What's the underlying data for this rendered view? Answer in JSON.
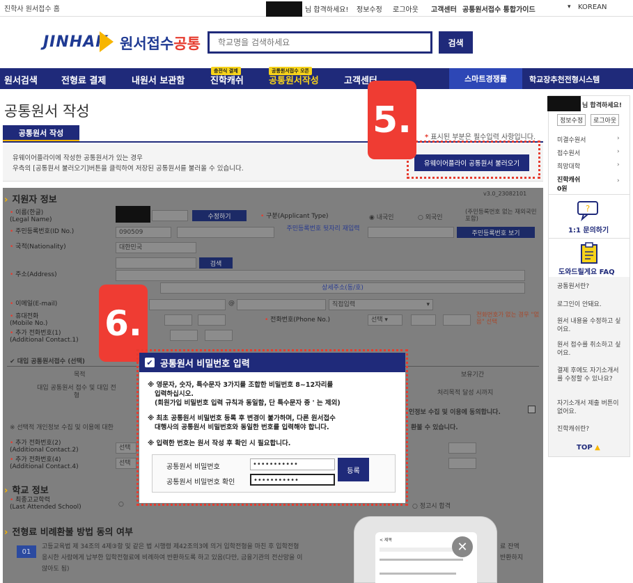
{
  "topbar": {
    "home": "진학사 원서접수 홈",
    "greeting": "님 합격하세요!",
    "links": [
      "정보수정",
      "로그아웃",
      "고객센터"
    ],
    "guide": "공통원서접수 통합가이드",
    "language": "KOREAN"
  },
  "header": {
    "logo_brand": "JINHAK",
    "logo_title_a": "원서접수",
    "logo_title_b": "공통",
    "search_placeholder": "학교명을 검색하세요",
    "search_button": "검색"
  },
  "nav": {
    "items": [
      "원서검색",
      "전형료 결제",
      "내원서 보관함",
      "진학캐쉬",
      "공통원서작성",
      "고객센터"
    ],
    "badges": {
      "cash": "충전식 결제",
      "common": "공통원서접수 오픈"
    },
    "smart": "스마트경쟁률",
    "school": "학교장추천전형시스템"
  },
  "page": {
    "title": "공통원서 작성",
    "tab": "공통원서 작성",
    "required_note_mark": "*",
    "required_note": "표시된 부분은 필수입력 사항입니다.",
    "info_line1": "유웨이어플라이에 작성한 공통원서가 있는 경우",
    "info_line2": "우측의 [공통원서 불러오기]버튼을 클릭하여 저장된 공통원서를 불러올 수 있습니다.",
    "load_button": "유웨이어플라이 공통원서 불러오기",
    "step5": "5.",
    "step6": "6."
  },
  "form": {
    "section1": "지원자 정보",
    "version": "v3.0_23082101",
    "name_label": "이름(한글)",
    "name_sub": "(Legal Name)",
    "edit_button": "수정하기",
    "type_label": "구분(Applicant Type)",
    "type_domestic": "내국인",
    "type_foreign": "외국인",
    "type_note": "(주민등록번호 없는 재외국민 포함)",
    "rrn_label": "주민등록번호(ID No.)",
    "rrn_value": "090509",
    "rrn_note": "주민등록번호 뒷자리 재입력",
    "rrn_show": "주민등록번호 보기",
    "nation_label": "국적(Nationality)",
    "nation_value": "대한민국",
    "addr_label": "주소(Address)",
    "addr_search": "검색",
    "addr_detail": "상세주소(동/호)",
    "email_label": "이메일(E-mail)",
    "email_at": "@",
    "email_direct": "직접입력",
    "mobile_label": "휴대전화",
    "mobile_sub": "(Mobile No.)",
    "phone_label": "전화번호(Phone No.)",
    "phone_select": "선택",
    "phone_note": "전화번호가 없는 경우 \"없음\" 선택",
    "extra1_label": "추가 전화번호(1)",
    "extra1_sub": "(Additional Contact.1)",
    "proxy_title": "대입 공통원서접수 (선택)",
    "th_purpose": "목적",
    "th_period": "보유기간",
    "td_purpose": "대입 공통원서 접수 및 대입 전형",
    "td_period": "처리목적 달성 시까지",
    "agree_text": "인정보 수집 및 이용에 동의합니다.",
    "optional_note": "※ 선택적 개인정보 수집 및 이용에 대한",
    "optional_note2": "환불 수 있습니다.",
    "extra2_label": "추가 전화번호(2)",
    "extra2_sub": "(Additional Contact.2)",
    "extra4_label": "추가 전화번호(4)",
    "extra4_sub": "(Additional Contact.4)",
    "select": "선택",
    "section2": "학교 정보",
    "school_label": "최종고교학력",
    "school_sub": "(Last Attended School)",
    "ged": "정고시 합격",
    "section3": "전형료 비례환불 방법 동의 여부",
    "refund_no": "01",
    "refund_line1": "고등교육법 제 34조의 4제③항 및 같은 법 시행령 제42조의3에 의거 입학전형을 마친 후 입학전형",
    "refund_line2": "응시한 사람에게 납부한 입학전형료에 비례하여 반환하도록 하고 있음(다만, 금융기관의 전산망을 이",
    "refund_line3": "않아도 됨)",
    "refund_tail1": "료 잔액",
    "refund_tail2": "반환하지"
  },
  "modal": {
    "title": "공통원서 비밀번호 입력",
    "note1a": "※ 영문자, 숫자, 특수문자 3가지를 조합한 비밀번호 8~12자리를",
    "note1b": "입력하십시오.",
    "note1c": "(회원가입 비밀번호 입력 규칙과 동일함, 단 특수문자 중 ' 는 제외)",
    "note2a": "※ 최초 공통원서 비밀번호 등록 후 변경이 불가하며, 다른 원서접수",
    "note2b": "대행사의 공통원서 비밀번호와 동일한 번호를 입력해야 합니다.",
    "note3": "※ 입력한 번호는 원서 작성 후 확인 시 필요합니다.",
    "pw_label": "공통원서 비밀번호",
    "pw_value": "•••••••••••",
    "pw_confirm_label": "공통원서 비밀번호 확인",
    "pw_confirm_value": "•••••••••••",
    "register": "등록"
  },
  "sidebar": {
    "greeting": "님 합격하세요!",
    "edit": "정보수정",
    "logout": "로그아웃",
    "menu": [
      "미결수원서",
      "접수원서",
      "희망대학"
    ],
    "cash_label": "진학캐쉬",
    "cash_value": "0원",
    "qa": "1:1 문의하기",
    "faq_title": "도와드릴게요 FAQ",
    "faq": [
      "공통원서란?",
      "로그인이 안돼요.",
      "원서 내용을 수정하고 싶어요.",
      "원서 접수를 취소하고 싶어요.",
      "결제 후에도 자기소개서를 수정할 수 있나요?",
      "자기소개서 제출 버튼이 없어요.",
      "진학캐쉬란?"
    ],
    "top": "TOP"
  },
  "phone": {
    "header": "< 제목"
  }
}
